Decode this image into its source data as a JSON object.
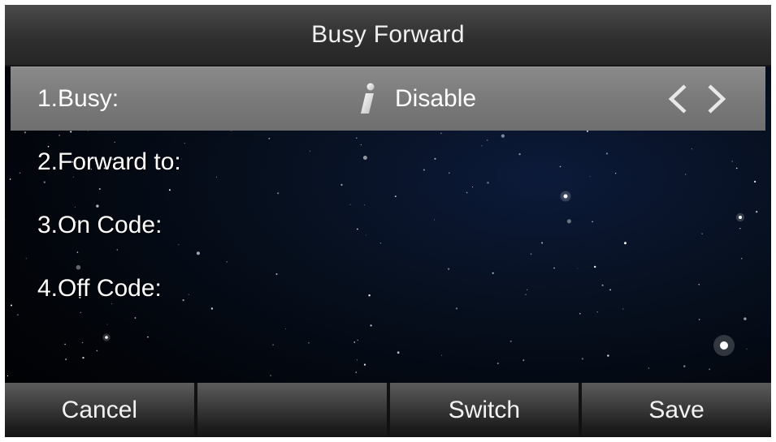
{
  "title": "Busy Forward",
  "rows": [
    {
      "label": "1.Busy:",
      "value": "Disable",
      "selected": true
    },
    {
      "label": "2.Forward to:",
      "value": ""
    },
    {
      "label": "3.On Code:",
      "value": ""
    },
    {
      "label": "4.Off Code:",
      "value": ""
    }
  ],
  "softkeys": [
    "Cancel",
    "",
    "Switch",
    "Save"
  ],
  "icons": {
    "info": "info-icon",
    "prev": "chevron-left-icon",
    "next": "chevron-right-icon"
  },
  "colors": {
    "title_bar": "#2e2e2e",
    "selected_row": "#7a7a7a",
    "text": "#ffffff"
  }
}
